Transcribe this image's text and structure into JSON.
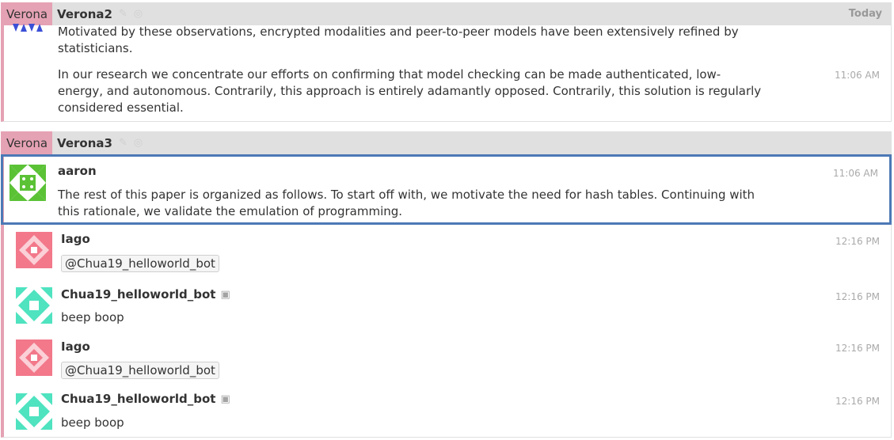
{
  "groups": [
    {
      "stream": "Verona",
      "topic": "Verona2",
      "date": "Today",
      "messages": [
        {
          "paragraphs": [
            "Motivated by these observations, encrypted modalities and peer-to-peer models have been extensively refined by statisticians.",
            "In our research we concentrate our efforts on confirming that model checking can be made authenticated, low-energy, and autonomous. Contrarily, this approach is entirely adamantly opposed. Contrarily, this solution is regularly considered essential."
          ],
          "time": "11:06 AM"
        }
      ]
    },
    {
      "stream": "Verona",
      "topic": "Verona3",
      "messages": [
        {
          "sender": "aaron",
          "time": "11:06 AM",
          "text": "The rest of this paper is organized as follows. To start off with, we motivate the need for hash tables. Continuing with this rationale, we validate the emulation of programming.",
          "avatar_color": "#5bc236",
          "selected": true
        },
        {
          "sender": "Iago",
          "time": "12:16 PM",
          "mention": "@Chua19_helloworld_bot",
          "avatar_color": "#f2788a"
        },
        {
          "sender": "Chua19_helloworld_bot",
          "time": "12:16 PM",
          "text": "beep boop",
          "avatar_color": "#4fe3c0",
          "is_bot": true
        },
        {
          "sender": "Iago",
          "time": "12:16 PM",
          "mention": "@Chua19_helloworld_bot",
          "avatar_color": "#f2788a"
        },
        {
          "sender": "Chua19_helloworld_bot",
          "time": "12:16 PM",
          "text": "beep boop",
          "avatar_color": "#4fe3c0",
          "is_bot": true
        }
      ]
    }
  ],
  "icons": {
    "edit": "pencil-icon",
    "mute": "eye-slash-icon",
    "bot": "bot-icon"
  }
}
